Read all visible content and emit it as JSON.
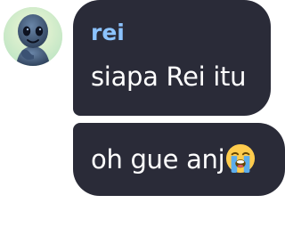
{
  "messages": [
    {
      "sender": "rei",
      "text": "siapa Rei itu",
      "avatar_icon": "alien-avatar-icon"
    },
    {
      "text": "oh gue anj",
      "emoji_icon": "loudly-crying-face-emoji"
    }
  ],
  "colors": {
    "bubble_bg": "#2a2b38",
    "sender_name": "#8cc3ff",
    "message_text": "#ffffff",
    "avatar_bg": "#cfe9c8"
  }
}
